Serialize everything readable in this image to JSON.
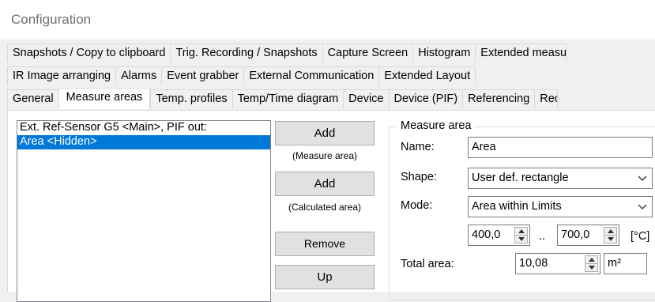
{
  "window": {
    "title": "Configuration"
  },
  "tabs": {
    "row1": [
      "Snapshots / Copy to clipboard",
      "Trig. Recording / Snapshots",
      "Capture Screen",
      "Histogram",
      "Extended measu"
    ],
    "row2": [
      "IR Image arranging",
      "Alarms",
      "Event grabber",
      "External Communication",
      "Extended Layout"
    ],
    "row3": [
      "General",
      "Measure areas",
      "Temp. profiles",
      "Temp/Time diagram",
      "Device",
      "Device (PIF)",
      "Referencing",
      "Rec"
    ],
    "active": "Measure areas"
  },
  "list": {
    "items": [
      "Ext. Ref-Sensor G5 <Main>, PIF out:",
      "Area <Hidden>"
    ],
    "selected_index": 1
  },
  "buttons": {
    "add_measure": "Add",
    "add_measure_caption": "(Measure area)",
    "add_calculated": "Add",
    "add_calculated_caption": "(Calculated area)",
    "remove": "Remove",
    "up": "Up"
  },
  "measure_area": {
    "group_label": "Measure area",
    "name_label": "Name:",
    "name_value": "Area",
    "shape_label": "Shape:",
    "shape_value": "User def. rectangle",
    "mode_label": "Mode:",
    "mode_value": "Area within Limits",
    "low_limit": "400,0",
    "range_separator": "..",
    "high_limit": "700,0",
    "temp_unit": "[°C]",
    "total_area_label": "Total area:",
    "total_area_value": "10,08",
    "area_unit": "m²"
  }
}
